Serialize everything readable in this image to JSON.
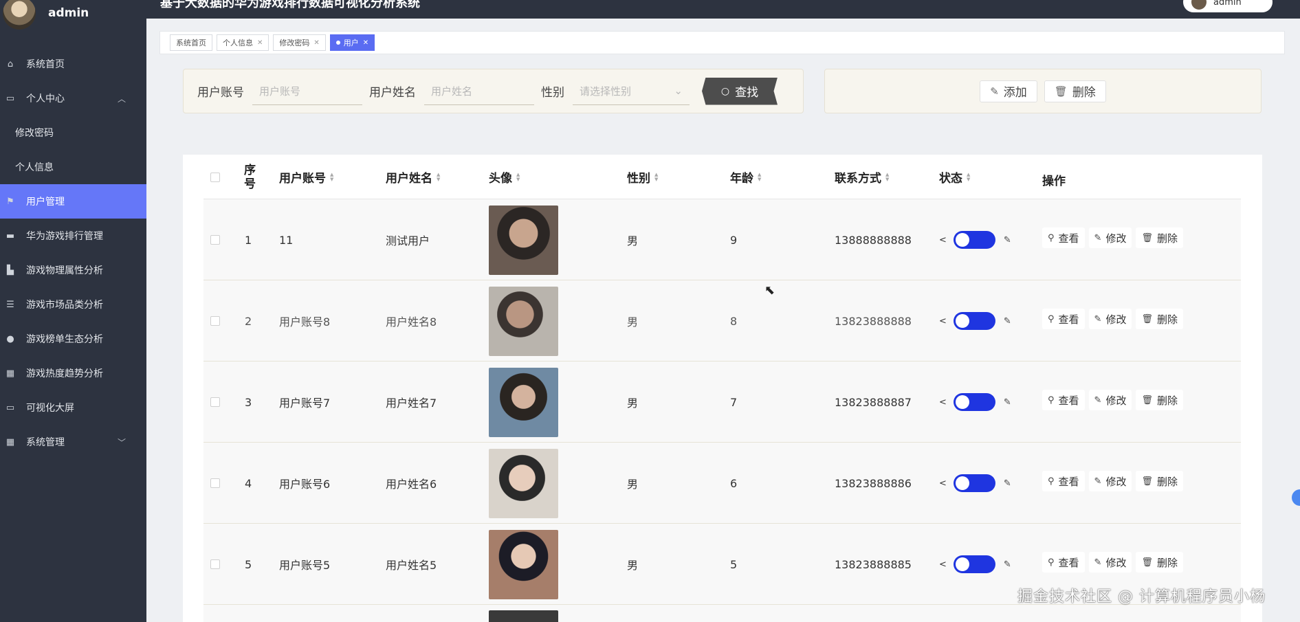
{
  "app": {
    "title": "基于大数据的华为游戏排行数据可视化分析系统",
    "user": "admin",
    "top_user": "admin"
  },
  "sidebar": {
    "items": [
      {
        "label": "系统首页",
        "icon": "home-icon"
      },
      {
        "label": "个人中心",
        "icon": "user-card-icon",
        "expanded": true
      },
      {
        "label": "修改密码",
        "sub": true
      },
      {
        "label": "个人信息",
        "sub": true
      },
      {
        "label": "用户管理",
        "icon": "flag-icon",
        "active": true
      },
      {
        "label": "华为游戏排行管理",
        "icon": "rank-icon"
      },
      {
        "label": "游戏物理属性分析",
        "icon": "chart-icon"
      },
      {
        "label": "游戏市场品类分析",
        "icon": "list-icon"
      },
      {
        "label": "游戏榜单生态分析",
        "icon": "person-icon"
      },
      {
        "label": "游戏热度趋势分析",
        "icon": "grid-icon"
      },
      {
        "label": "可视化大屏",
        "icon": "screen-icon"
      },
      {
        "label": "系统管理",
        "icon": "grid-icon",
        "expandable": true
      }
    ]
  },
  "tabs": [
    {
      "label": "系统首页",
      "closable": false
    },
    {
      "label": "个人信息",
      "closable": true
    },
    {
      "label": "修改密码",
      "closable": true
    },
    {
      "label": "用户",
      "closable": true,
      "active": true
    }
  ],
  "search": {
    "account_label": "用户账号",
    "account_placeholder": "用户账号",
    "name_label": "用户姓名",
    "name_placeholder": "用户姓名",
    "gender_label": "性别",
    "gender_placeholder": "请选择性别",
    "find_label": "查找"
  },
  "actions": {
    "add_label": "添加",
    "delete_label": "删除"
  },
  "table": {
    "headers": {
      "index": "序号",
      "account": "用户账号",
      "name": "用户姓名",
      "avatar": "头像",
      "gender": "性别",
      "age": "年龄",
      "phone": "联系方式",
      "status": "状态",
      "ops": "操作"
    },
    "op_labels": {
      "view": "查看",
      "edit": "修改",
      "delete": "删除"
    },
    "rows": [
      {
        "index": "1",
        "account": "11",
        "name": "测试用户",
        "gender": "男",
        "age": "9",
        "phone": "13888888888",
        "status_on": true
      },
      {
        "index": "2",
        "account": "用户账号8",
        "name": "用户姓名8",
        "gender": "男",
        "age": "8",
        "phone": "13823888888",
        "status_on": true
      },
      {
        "index": "3",
        "account": "用户账号7",
        "name": "用户姓名7",
        "gender": "男",
        "age": "7",
        "phone": "13823888887",
        "status_on": true
      },
      {
        "index": "4",
        "account": "用户账号6",
        "name": "用户姓名6",
        "gender": "男",
        "age": "6",
        "phone": "13823888886",
        "status_on": true
      },
      {
        "index": "5",
        "account": "用户账号5",
        "name": "用户姓名5",
        "gender": "男",
        "age": "5",
        "phone": "13823888885",
        "status_on": true
      }
    ]
  },
  "watermark": "掘金技术社区 @ 计算机程序员小杨",
  "colors": {
    "sidebar_bg": "#2d3340",
    "active_menu": "#6577f8",
    "toggle_on": "#1f35e0",
    "panel_bg": "#f7f5ee"
  }
}
